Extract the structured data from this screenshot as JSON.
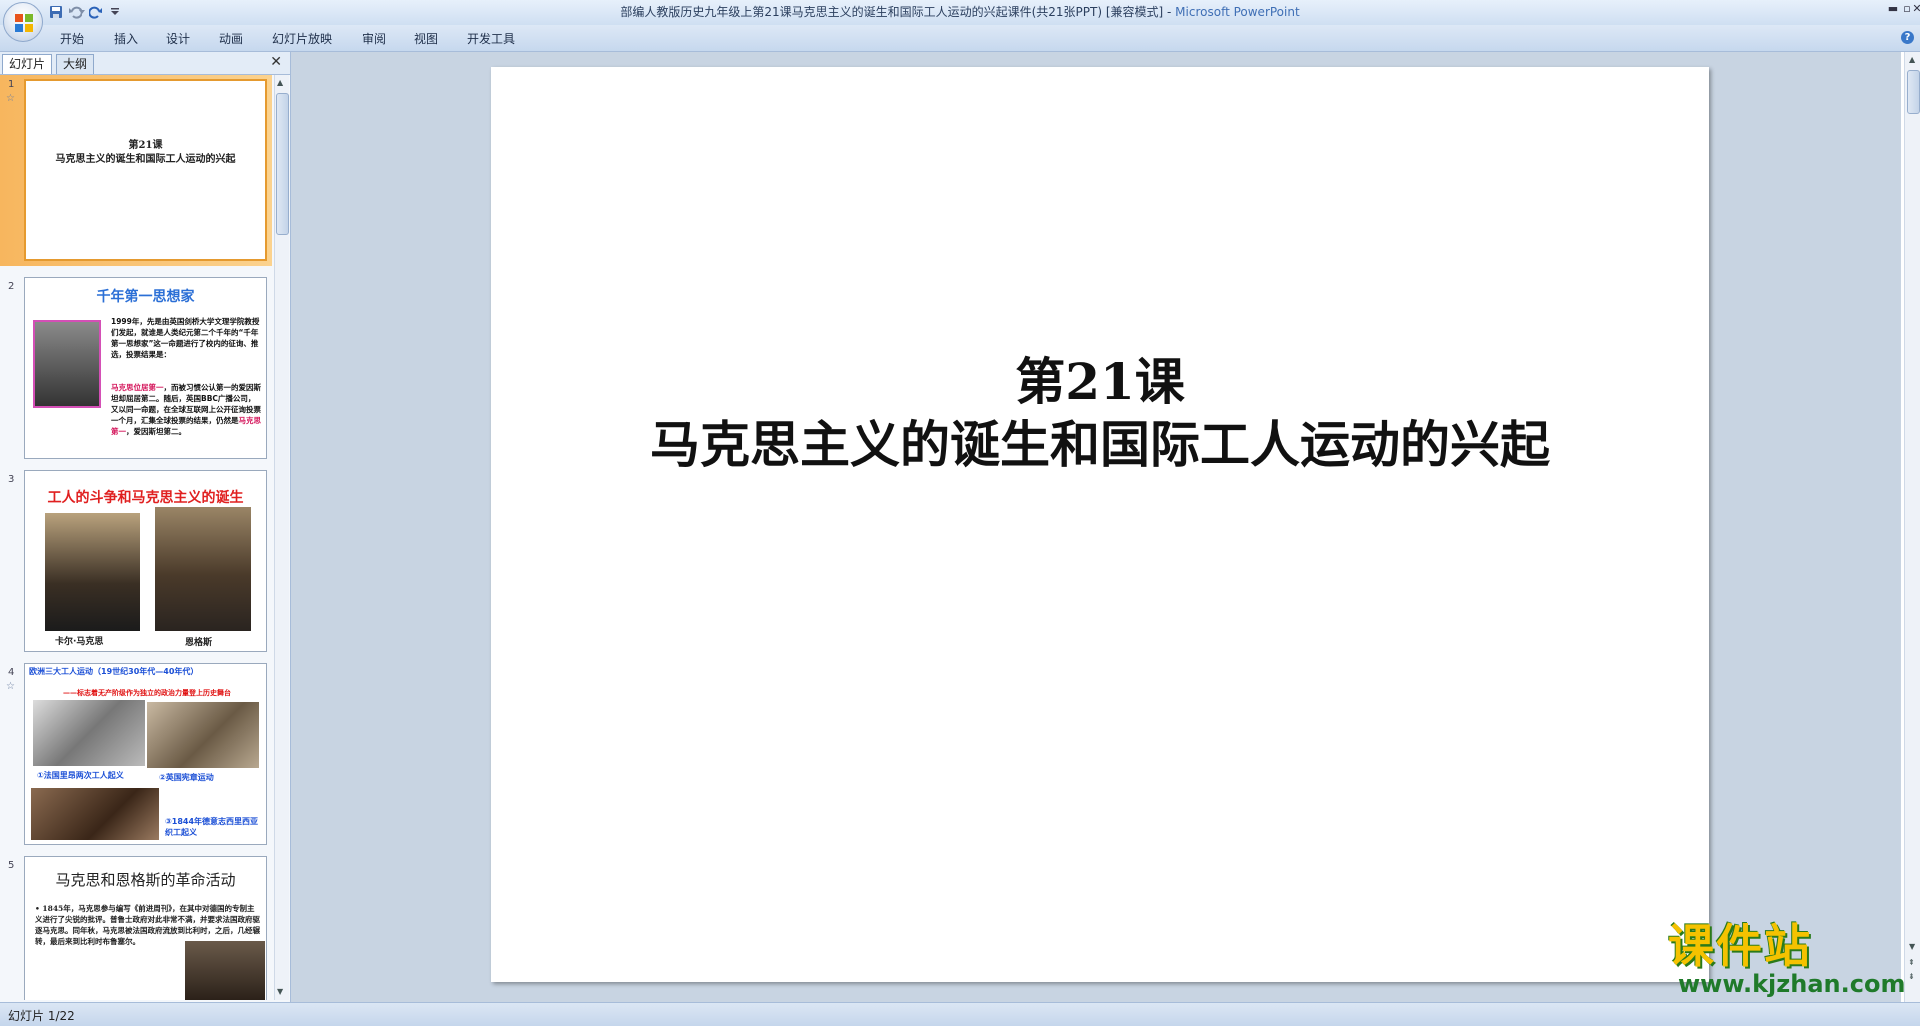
{
  "window": {
    "title": "部编人教版历史九年级上第21课马克思主义的诞生和国际工人运动的兴起课件(共21张PPT) [兼容模式]",
    "app_name": "Microsoft PowerPoint",
    "separator": " - "
  },
  "ribbon": {
    "tabs": [
      "开始",
      "插入",
      "设计",
      "动画",
      "幻灯片放映",
      "审阅",
      "视图",
      "开发工具"
    ],
    "help": "?"
  },
  "left_pane": {
    "tabs": [
      "幻灯片",
      "大纲"
    ],
    "close": "✕"
  },
  "thumbnails": [
    {
      "num": "1",
      "title_line1": "第21课",
      "title_line2": "马克思主义的诞生和国际工人运动的兴起"
    },
    {
      "num": "2",
      "heading": "千年第一思想家",
      "para1": "1999年，先是由英国剑桥大学文理学院教授们发起，就谁是人类纪元第二个千年的“千年第一思想家”这一命题进行了校内的征询、推选，投票结果是：",
      "para2_hl": "马克思位居第一",
      "para2_rest": "，而被习惯公认第一的爱因斯坦却屈居第二。随后，英国BBC广播公司，又以同一命题，在全球互联网上公开征询投票一个月，汇集全球投票的结果，仍然是",
      "para2_hl2": "马克思第一",
      "para2_end": "，爱因斯坦第二。"
    },
    {
      "num": "3",
      "heading": "工人的斗争和马克思主义的诞生",
      "caption1": "卡尔·马克思",
      "caption2": "恩格斯"
    },
    {
      "num": "4",
      "heading": "欧洲三大工人运动（19世纪30年代—40年代）",
      "sub": "——标志着无产阶级作为独立的政治力量登上历史舞台",
      "cap1": "①法国里昂两次工人起义",
      "cap2": "②英国宪章运动",
      "cap3": "③1844年德意志西里西亚织工起义"
    },
    {
      "num": "5",
      "heading": "马克思和恩格斯的革命活动",
      "text": "• 1845年，马克思参与编写《前进周刊》，在其中对德国的专制主义进行了尖锐的批评。普鲁士政府对此非常不满，并要求法国政府驱逐马克思。同年秋，马克思被法国政府流放到比利时，之后，几经辗转，最后来到比利时布鲁塞尔。"
    }
  ],
  "slide": {
    "line1": "第21课",
    "line2": "马克思主义的诞生和国际工人运动的兴起"
  },
  "status": {
    "text": "幻灯片 1/22"
  },
  "watermark": {
    "cn": "课件站",
    "url": "www.kjzhan.com"
  }
}
